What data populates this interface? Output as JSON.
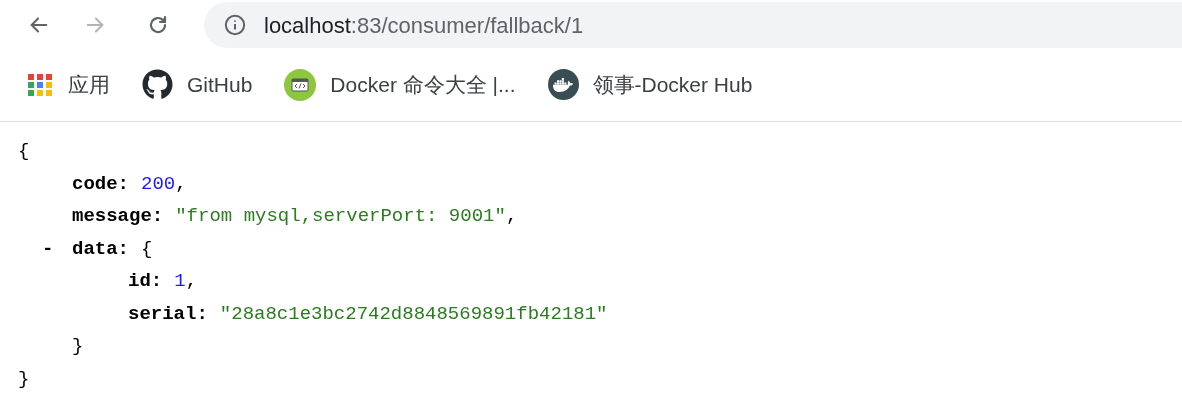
{
  "toolbar": {
    "back": {
      "disabled": false
    },
    "forward": {
      "disabled": true
    }
  },
  "address_bar": {
    "host": "localhost",
    "path": ":83/consumer/fallback/1"
  },
  "bookmarks": [
    {
      "kind": "apps",
      "label": "应用"
    },
    {
      "kind": "github",
      "label": "GitHub"
    },
    {
      "kind": "code",
      "label": "Docker 命令大全 |..."
    },
    {
      "kind": "docker",
      "label": "领事-Docker Hub"
    }
  ],
  "json_view": {
    "open": "{",
    "close": "}",
    "entries": [
      {
        "key": "code:",
        "value": {
          "kind": "number",
          "text": "200"
        },
        "comma": ","
      },
      {
        "key": "message:",
        "value": {
          "kind": "string",
          "text": "\"from mysql,serverPort: 9001\""
        },
        "comma": ","
      },
      {
        "key": "data:",
        "toggle": "-",
        "expanded": true,
        "open": "{",
        "close": "}",
        "children": [
          {
            "key": "id:",
            "value": {
              "kind": "number",
              "text": "1"
            },
            "comma": ","
          },
          {
            "key": "serial:",
            "value": {
              "kind": "string",
              "text": "\"28a8c1e3bc2742d8848569891fb42181\""
            }
          }
        ]
      }
    ]
  }
}
